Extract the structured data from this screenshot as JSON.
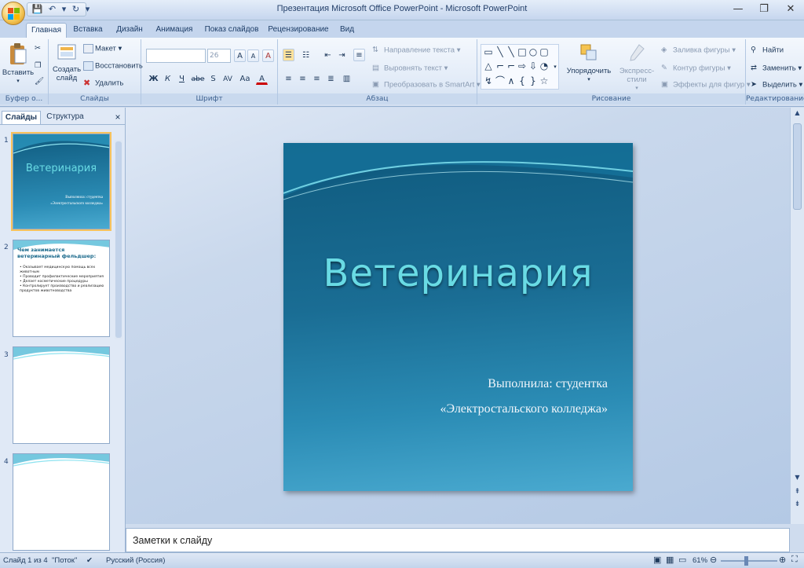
{
  "window": {
    "title": "Презентация Microsoft Office PowerPoint - Microsoft PowerPoint",
    "controls": [
      "—",
      "❐",
      "✕"
    ]
  },
  "qat": {
    "save": "💾",
    "undo": "↶",
    "undo_arrow": "▾",
    "redo": "↻",
    "customize": "▾"
  },
  "tabs": [
    "Главная",
    "Вставка",
    "Дизайн",
    "Анимация",
    "Показ слайдов",
    "Рецензирование",
    "Вид"
  ],
  "ribbon": {
    "clipboard": {
      "paste": "Вставить",
      "label": "Буфер о..."
    },
    "slides": {
      "create": "Создать",
      "create2": "слайд",
      "layout": "Макет",
      "reset": "Восстановить",
      "delete": "Удалить",
      "label": "Слайды"
    },
    "font": {
      "font_value": "",
      "size_value": "26",
      "grow": "A",
      "shrink": "A",
      "clear": "A",
      "bold": "Ж",
      "italic": "К",
      "underline": "Ч",
      "strike": "abe",
      "shadow": "S",
      "spacing": "AV",
      "case": "Aa",
      "color": "A",
      "label": "Шрифт"
    },
    "paragraph": {
      "direction": "Направление текста",
      "align": "Выровнять текст",
      "smartart": "Преобразовать в SmartArt",
      "label": "Абзац"
    },
    "drawing": {
      "arrange": "Упорядочить",
      "express": "Экспресс-стили",
      "fill": "Заливка фигуры",
      "outline": "Контур фигуры",
      "effects": "Эффекты для фигур",
      "label": "Рисование"
    },
    "editing": {
      "find": "Найти",
      "replace": "Заменить",
      "select": "Выделить",
      "label": "Редактирование"
    }
  },
  "leftpane": {
    "tab_slides": "Слайды",
    "tab_outline": "Структура",
    "close": "×",
    "thumbs": [
      {
        "num": "1",
        "title": "Ветеринария",
        "sub1": "Выполнила: студентка",
        "sub2": "«Электростальского колледжа»"
      },
      {
        "num": "2",
        "title": "Чем занимается ветеринарный фельдшер:",
        "bullets": [
          "Оказывает медицинскую помощь всех животным",
          "Проводит профилактические мероприятия",
          "Делает косметические процедуры",
          "Контролирует производство и реализацию продуктов животноводства"
        ]
      },
      {
        "num": "3"
      },
      {
        "num": "4"
      }
    ]
  },
  "slide": {
    "title": "Ветеринария",
    "subtitle_line1": "Выполнила: студентка",
    "subtitle_line2": "«Электростальского колледжа»"
  },
  "notes": {
    "placeholder": "Заметки к слайду"
  },
  "status": {
    "slide_info": "Слайд 1 из 4",
    "theme": "\"Поток\"",
    "language": "Русский (Россия)",
    "zoom": "61%"
  },
  "colors": {
    "accent": "#c4d5ed",
    "slide_title": "#69dbe4"
  }
}
